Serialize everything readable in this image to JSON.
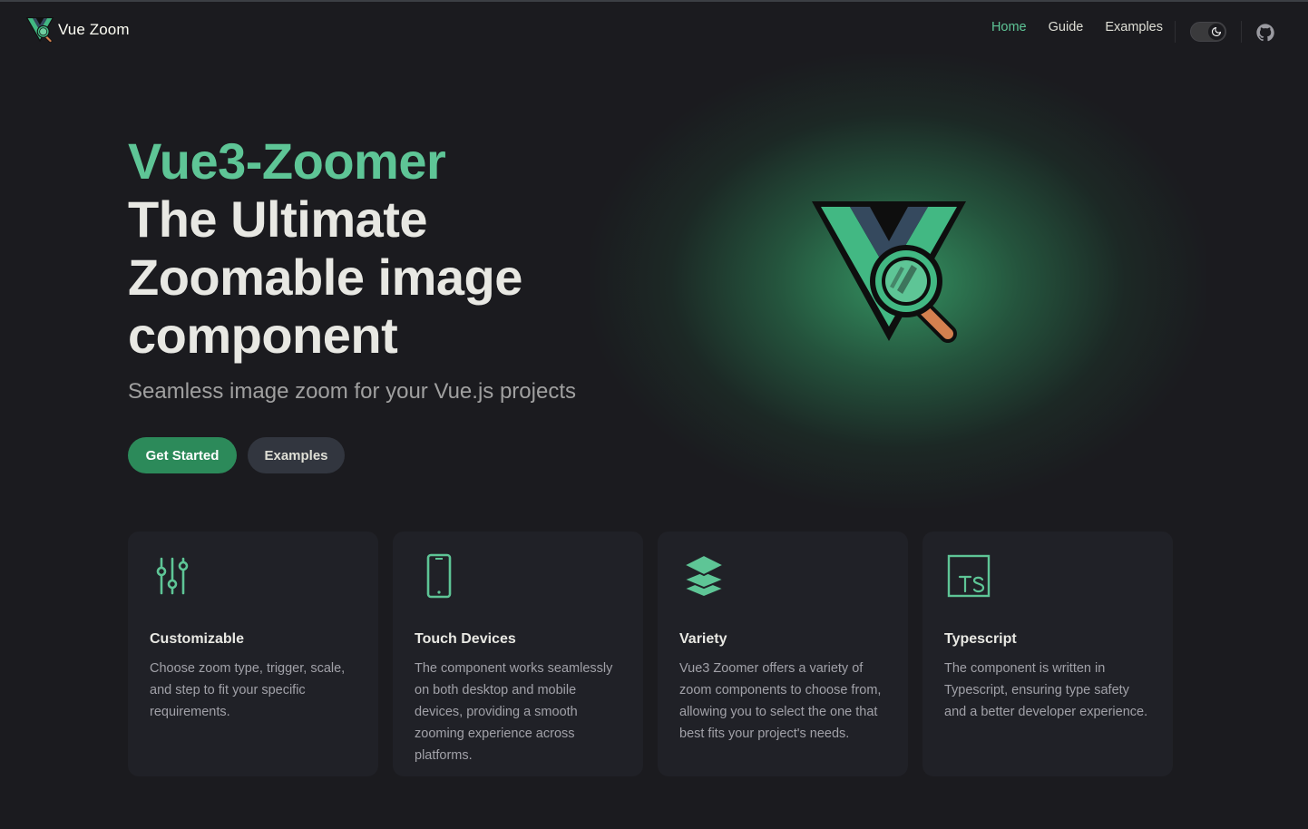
{
  "nav": {
    "brand": "Vue Zoom",
    "links": [
      {
        "label": "Home",
        "active": true
      },
      {
        "label": "Guide",
        "active": false
      },
      {
        "label": "Examples",
        "active": false
      }
    ],
    "theme_toggle_icon": "moon-icon",
    "github_icon": "github-icon"
  },
  "hero": {
    "name": "Vue3-Zoomer",
    "tagline_lines": [
      "The Ultimate",
      "Zoomable image",
      "component"
    ],
    "subtitle": "Seamless image zoom for your Vue.js projects",
    "primary_action": "Get Started",
    "secondary_action": "Examples"
  },
  "features": [
    {
      "icon": "sliders-icon",
      "title": "Customizable",
      "details": "Choose zoom type, trigger, scale, and step to fit your specific requirements."
    },
    {
      "icon": "mobile-phone-icon",
      "title": "Touch Devices",
      "details": "The component works seamlessly on both desktop and mobile devices, providing a smooth zooming experience across platforms."
    },
    {
      "icon": "layers-icon",
      "title": "Variety",
      "details": "Vue3 Zoomer offers a variety of zoom components to choose from, allowing you to select the one that best fits your project's needs."
    },
    {
      "icon": "typescript-icon",
      "title": "Typescript",
      "details": "The component is written in Typescript, ensuring type safety and a better developer experience."
    }
  ],
  "colors": {
    "accent": "#5ec596",
    "brand_button": "#2c8a5a",
    "background": "#1b1b1f",
    "card": "#202127"
  }
}
